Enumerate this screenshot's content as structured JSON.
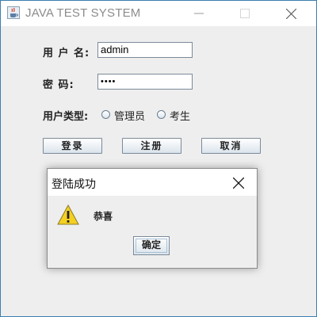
{
  "window": {
    "title": "JAVA TEST SYSTEM",
    "icon": "java-cup-icon",
    "controls": [
      "minimize-icon",
      "maximize-icon",
      "close-icon"
    ]
  },
  "form": {
    "username_label": "用 户 名:",
    "username_value": "admin",
    "password_label": "密 码:",
    "password_value": "••••",
    "user_type_label": "用户类型:",
    "user_type_options": [
      "管理员",
      "考生"
    ],
    "buttons": {
      "login": "登录",
      "register": "注册",
      "cancel": "取消"
    }
  },
  "dialog": {
    "title": "登陆成功",
    "message": "恭喜",
    "ok_label": "确定",
    "icon": "warning-icon"
  },
  "colors": {
    "window_border": "#3c7fb1",
    "background": "#eeeeee",
    "warning_fill": "#f5d020"
  }
}
